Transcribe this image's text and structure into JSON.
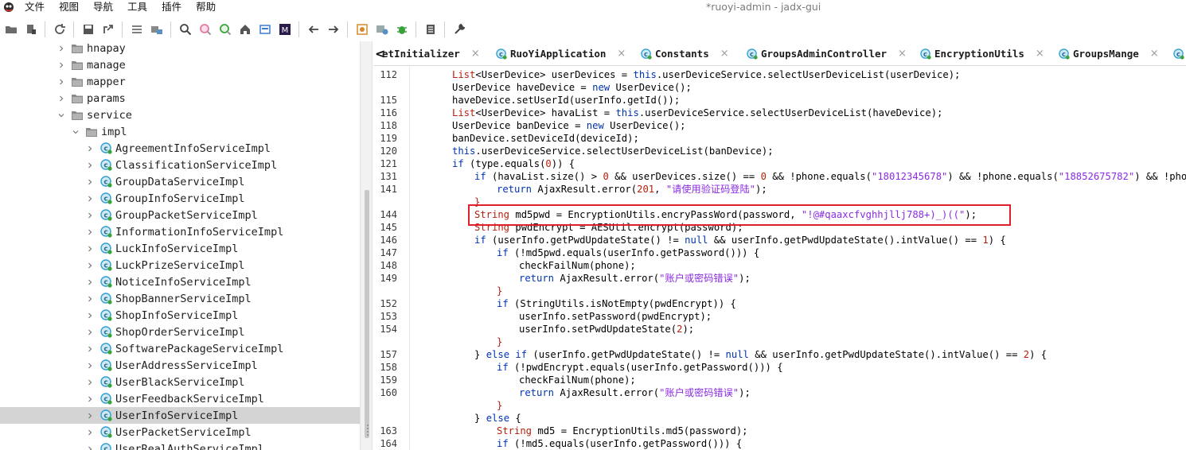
{
  "menubar": {
    "items": [
      "文件",
      "视图",
      "导航",
      "工具",
      "插件",
      "帮助"
    ],
    "window_title": "*ruoyi-admin - jadx-gui"
  },
  "toolbar": {
    "buttons": [
      "open-icon",
      "add-files-icon",
      "sep",
      "reload-icon",
      "sep",
      "save-icon",
      "export-icon",
      "sep",
      "sync-icon",
      "flat-packages-icon",
      "sep",
      "search-icon",
      "find-class-icon",
      "find-usage-icon",
      "home-icon",
      "deobf-icon",
      "m-icon",
      "sep",
      "back-icon",
      "forward-icon",
      "sep",
      "quark-icon",
      "decompile-all-icon",
      "debug-icon",
      "sep",
      "log-icon",
      "sep",
      "settings-icon"
    ]
  },
  "tree": {
    "rows": [
      {
        "label": "hnapay",
        "indent": 1,
        "kind": "folder",
        "expanded": false
      },
      {
        "label": "manage",
        "indent": 1,
        "kind": "folder",
        "expanded": false
      },
      {
        "label": "mapper",
        "indent": 1,
        "kind": "folder",
        "expanded": false
      },
      {
        "label": "params",
        "indent": 1,
        "kind": "folder",
        "expanded": false
      },
      {
        "label": "service",
        "indent": 1,
        "kind": "folder",
        "expanded": true
      },
      {
        "label": "impl",
        "indent": 2,
        "kind": "folder",
        "expanded": true
      },
      {
        "label": "AgreementInfoServiceImpl",
        "indent": 3,
        "kind": "class"
      },
      {
        "label": "ClassificationServiceImpl",
        "indent": 3,
        "kind": "class"
      },
      {
        "label": "GroupDataServiceImpl",
        "indent": 3,
        "kind": "class"
      },
      {
        "label": "GroupInfoServiceImpl",
        "indent": 3,
        "kind": "class"
      },
      {
        "label": "GroupPacketServiceImpl",
        "indent": 3,
        "kind": "class"
      },
      {
        "label": "InformationInfoServiceImpl",
        "indent": 3,
        "kind": "class"
      },
      {
        "label": "LuckInfoServiceImpl",
        "indent": 3,
        "kind": "class"
      },
      {
        "label": "LuckPrizeServiceImpl",
        "indent": 3,
        "kind": "class"
      },
      {
        "label": "NoticeInfoServiceImpl",
        "indent": 3,
        "kind": "class"
      },
      {
        "label": "ShopBannerServiceImpl",
        "indent": 3,
        "kind": "class"
      },
      {
        "label": "ShopInfoServiceImpl",
        "indent": 3,
        "kind": "class"
      },
      {
        "label": "ShopOrderServiceImpl",
        "indent": 3,
        "kind": "class"
      },
      {
        "label": "SoftwarePackageServiceImpl",
        "indent": 3,
        "kind": "class"
      },
      {
        "label": "UserAddressServiceImpl",
        "indent": 3,
        "kind": "class"
      },
      {
        "label": "UserBlackServiceImpl",
        "indent": 3,
        "kind": "class"
      },
      {
        "label": "UserFeedbackServiceImpl",
        "indent": 3,
        "kind": "class"
      },
      {
        "label": "UserInfoServiceImpl",
        "indent": 3,
        "kind": "class",
        "selected": true
      },
      {
        "label": "UserPacketServiceImpl",
        "indent": 3,
        "kind": "class"
      },
      {
        "label": "UserRealAuthServiceImpl",
        "indent": 3,
        "kind": "class"
      }
    ]
  },
  "tabs": [
    {
      "label": "etInitializer",
      "icon": false
    },
    {
      "label": "RuoYiApplication",
      "icon": true
    },
    {
      "label": "Constants",
      "icon": true
    },
    {
      "label": "GroupsAdminController",
      "icon": true
    },
    {
      "label": "EncryptionUtils",
      "icon": true
    },
    {
      "label": "GroupsMange",
      "icon": true
    },
    {
      "label": "",
      "icon": true
    }
  ],
  "tab_close_glyph": "×",
  "tab_nav_glyph": "<",
  "code": {
    "lines": [
      {
        "n": "112",
        "indent": 3,
        "t": [
          [
            "typ",
            "List"
          ],
          [
            "",
            "<UserDevice> userDevices = "
          ],
          [
            "kw",
            "this"
          ],
          [
            "",
            ".userDeviceService.selectUserDeviceList(userDevice);"
          ]
        ]
      },
      {
        "n": "",
        "indent": 3,
        "t": [
          [
            "",
            "UserDevice haveDevice = "
          ],
          [
            "kw",
            "new"
          ],
          [
            "",
            " UserDevice();"
          ]
        ]
      },
      {
        "n": "115",
        "indent": 3,
        "t": [
          [
            "",
            "haveDevice.setUserId(userInfo.getId());"
          ]
        ]
      },
      {
        "n": "116",
        "indent": 3,
        "t": [
          [
            "typ",
            "List"
          ],
          [
            "",
            "<UserDevice> havaList = "
          ],
          [
            "kw",
            "this"
          ],
          [
            "",
            ".userDeviceService.selectUserDeviceList(haveDevice);"
          ]
        ]
      },
      {
        "n": "118",
        "indent": 3,
        "t": [
          [
            "",
            "UserDevice banDevice = "
          ],
          [
            "kw",
            "new"
          ],
          [
            "",
            " UserDevice();"
          ]
        ]
      },
      {
        "n": "119",
        "indent": 3,
        "t": [
          [
            "",
            "banDevice.setDeviceId(deviceId);"
          ]
        ]
      },
      {
        "n": "120",
        "indent": 3,
        "t": [
          [
            "kw",
            "this"
          ],
          [
            "",
            ".userDeviceService.selectUserDeviceList(banDevice);"
          ]
        ]
      },
      {
        "n": "121",
        "indent": 3,
        "t": [
          [
            "kw",
            "if"
          ],
          [
            "",
            " (type.equals("
          ],
          [
            "num",
            "0"
          ],
          [
            "",
            ")) {"
          ]
        ]
      },
      {
        "n": "131",
        "indent": 4,
        "t": [
          [
            "kw",
            "if"
          ],
          [
            "",
            " (havaList.size() > "
          ],
          [
            "num",
            "0"
          ],
          [
            "",
            " && userDevices.size() == "
          ],
          [
            "num",
            "0"
          ],
          [
            "",
            " && !phone.equals("
          ],
          [
            "str",
            "\"18012345678\""
          ],
          [
            "",
            ") && !phone.equals("
          ],
          [
            "str",
            "\"18852675782\""
          ],
          [
            "",
            ") && !phone.eq"
          ]
        ]
      },
      {
        "n": "141",
        "indent": 5,
        "t": [
          [
            "kw",
            "return"
          ],
          [
            "",
            " AjaxResult.error("
          ],
          [
            "num",
            "201"
          ],
          [
            "",
            ", "
          ],
          [
            "str",
            "\"请使用验证码登陆\""
          ],
          [
            "",
            ");"
          ]
        ]
      },
      {
        "n": "",
        "indent": 4,
        "t": [
          [
            "typ",
            "}"
          ]
        ]
      },
      {
        "n": "144",
        "indent": 4,
        "t": [
          [
            "typ",
            "String"
          ],
          [
            "",
            " md5pwd = EncryptionUtils.encryPassWord(password, "
          ],
          [
            "str",
            "\"!@#qaaxcfvghhjllj788+)_)((\""
          ],
          [
            "",
            ");"
          ]
        ]
      },
      {
        "n": "145",
        "indent": 4,
        "t": [
          [
            "typ",
            "String"
          ],
          [
            "",
            " pwdEncrypt = AESUtil.encrypt(password);"
          ]
        ]
      },
      {
        "n": "146",
        "indent": 4,
        "t": [
          [
            "kw",
            "if"
          ],
          [
            "",
            " (userInfo.getPwdUpdateState() != "
          ],
          [
            "kw",
            "null"
          ],
          [
            "",
            " && userInfo.getPwdUpdateState().intValue() == "
          ],
          [
            "num",
            "1"
          ],
          [
            "",
            ") {"
          ]
        ]
      },
      {
        "n": "147",
        "indent": 5,
        "t": [
          [
            "kw",
            "if"
          ],
          [
            "",
            " (!md5pwd.equals(userInfo.getPassword())) {"
          ]
        ]
      },
      {
        "n": "148",
        "indent": 6,
        "t": [
          [
            "",
            "checkFailNum(phone);"
          ]
        ]
      },
      {
        "n": "149",
        "indent": 6,
        "t": [
          [
            "kw",
            "return"
          ],
          [
            "",
            " AjaxResult.error("
          ],
          [
            "str",
            "\"账户或密码错误\""
          ],
          [
            "",
            ");"
          ]
        ]
      },
      {
        "n": "",
        "indent": 5,
        "t": [
          [
            "typ",
            "}"
          ]
        ]
      },
      {
        "n": "152",
        "indent": 5,
        "t": [
          [
            "kw",
            "if"
          ],
          [
            "",
            " (StringUtils.isNotEmpty(pwdEncrypt)) {"
          ]
        ]
      },
      {
        "n": "153",
        "indent": 6,
        "t": [
          [
            "",
            "userInfo.setPassword(pwdEncrypt);"
          ]
        ]
      },
      {
        "n": "154",
        "indent": 6,
        "t": [
          [
            "",
            "userInfo.setPwdUpdateState("
          ],
          [
            "num",
            "2"
          ],
          [
            "",
            ");"
          ]
        ]
      },
      {
        "n": "",
        "indent": 5,
        "t": [
          [
            "typ",
            "}"
          ]
        ]
      },
      {
        "n": "157",
        "indent": 4,
        "t": [
          [
            "",
            "} "
          ],
          [
            "kw",
            "else if"
          ],
          [
            "",
            " (userInfo.getPwdUpdateState() != "
          ],
          [
            "kw",
            "null"
          ],
          [
            "",
            " && userInfo.getPwdUpdateState().intValue() == "
          ],
          [
            "num",
            "2"
          ],
          [
            "",
            ") {"
          ]
        ]
      },
      {
        "n": "158",
        "indent": 5,
        "t": [
          [
            "kw",
            "if"
          ],
          [
            "",
            " (!pwdEncrypt.equals(userInfo.getPassword())) {"
          ]
        ]
      },
      {
        "n": "159",
        "indent": 6,
        "t": [
          [
            "",
            "checkFailNum(phone);"
          ]
        ]
      },
      {
        "n": "160",
        "indent": 6,
        "t": [
          [
            "kw",
            "return"
          ],
          [
            "",
            " AjaxResult.error("
          ],
          [
            "str",
            "\"账户或密码错误\""
          ],
          [
            "",
            ");"
          ]
        ]
      },
      {
        "n": "",
        "indent": 5,
        "t": [
          [
            "typ",
            "}"
          ]
        ]
      },
      {
        "n": "",
        "indent": 4,
        "t": [
          [
            "",
            "} "
          ],
          [
            "kw",
            "else"
          ],
          [
            "",
            " {"
          ]
        ]
      },
      {
        "n": "163",
        "indent": 5,
        "t": [
          [
            "typ",
            "String"
          ],
          [
            "",
            " md5 = EncryptionUtils.md5(password);"
          ]
        ]
      },
      {
        "n": "164",
        "indent": 5,
        "t": [
          [
            "kw",
            "if"
          ],
          [
            "",
            " (!md5.equals(userInfo.getPassword())) {"
          ]
        ]
      }
    ]
  },
  "colors": {
    "accent_class": "#2e9fd0",
    "class_green": "#3aa23a",
    "highlight_box": "#e0202a",
    "selected_row": "#d4d4d4"
  }
}
